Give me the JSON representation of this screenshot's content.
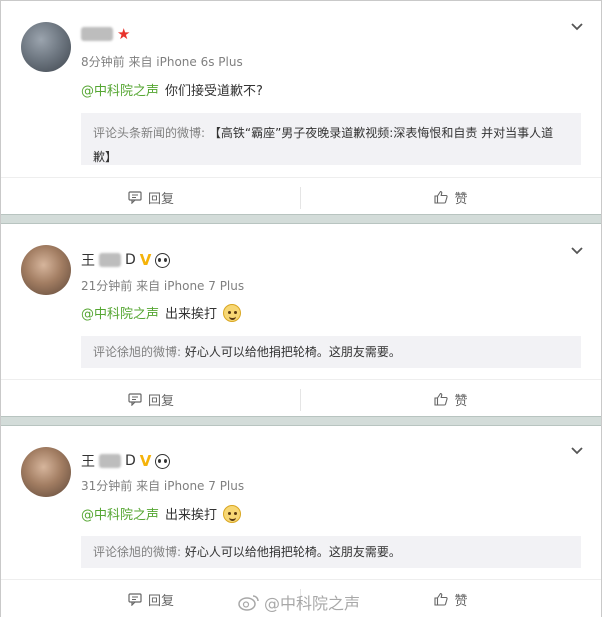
{
  "posts": [
    {
      "username_suffix": "",
      "time": "8分钟前",
      "source": "来自 iPhone 6s Plus",
      "mention": "@中科院之声",
      "comment": "你们接受道歉不?",
      "quote_prefix": "评论头条新闻的微博:",
      "quote_text": "【高铁“霸座”男子夜晚录道歉视频:深表悔恨和自责 并对当事人道歉】",
      "reply_label": "回复",
      "like_label": "赞"
    },
    {
      "username_prefix": "王",
      "username_suffix": "D",
      "time": "21分钟前",
      "source": "来自 iPhone 7 Plus",
      "mention": "@中科院之声",
      "comment": "出来挨打",
      "quote_prefix": "评论徐旭的微博:",
      "quote_text": "好心人可以给他捐把轮椅。这朋友需要。",
      "reply_label": "回复",
      "like_label": "赞"
    },
    {
      "username_prefix": "王",
      "username_suffix": "D",
      "time": "31分钟前",
      "source": "来自 iPhone 7 Plus",
      "mention": "@中科院之声",
      "comment": "出来挨打",
      "quote_prefix": "评论徐旭的微博:",
      "quote_text": "好心人可以给他捐把轮椅。这朋友需要。",
      "reply_label": "回复",
      "like_label": "赞"
    }
  ],
  "watermark": "@中科院之声",
  "icons": [
    "chevron-down-icon",
    "reply-icon",
    "thumbs-up-icon",
    "verified-v-icon",
    "panda-icon",
    "star-icon",
    "weibo-logo-icon",
    "emoji-icon"
  ],
  "colors": {
    "mention": "#55a632",
    "divider": "#d3dcd9",
    "quote_bg": "#f2f2f5",
    "star": "#e8322b",
    "v_badge": "#f5b30a"
  }
}
